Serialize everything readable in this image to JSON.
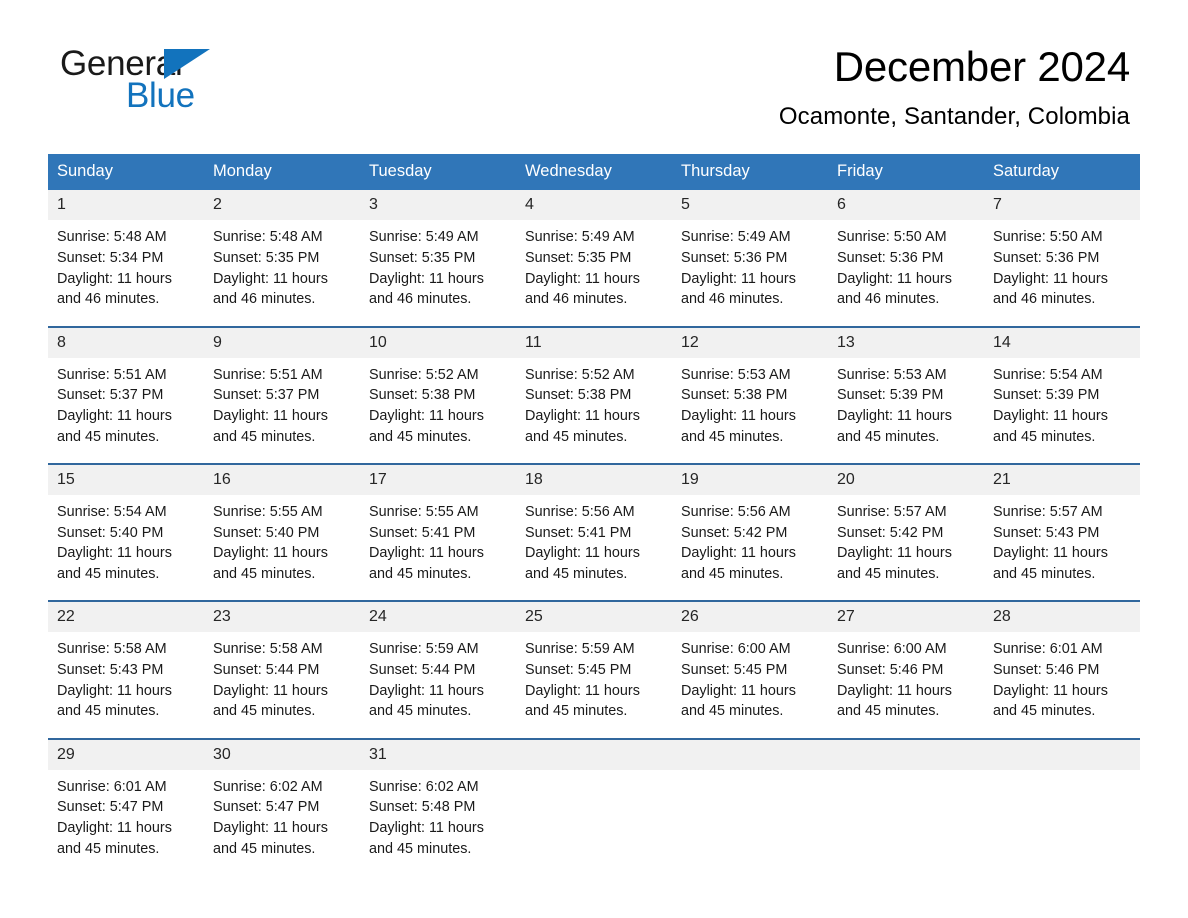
{
  "brand": {
    "name_part1": "General",
    "name_part2": "Blue",
    "accent_color": "#1273bd"
  },
  "header": {
    "title": "December 2024",
    "location": "Ocamonte, Santander, Colombia"
  },
  "theme": {
    "header_blue": "#3076b8",
    "row_divider_blue": "#31679d",
    "daynum_background": "#f1f1f1"
  },
  "calendar": {
    "weekday_headers": [
      "Sunday",
      "Monday",
      "Tuesday",
      "Wednesday",
      "Thursday",
      "Friday",
      "Saturday"
    ],
    "weeks": [
      [
        {
          "day": "1",
          "sunrise": "Sunrise: 5:48 AM",
          "sunset": "Sunset: 5:34 PM",
          "daylight": "Daylight: 11 hours and 46 minutes."
        },
        {
          "day": "2",
          "sunrise": "Sunrise: 5:48 AM",
          "sunset": "Sunset: 5:35 PM",
          "daylight": "Daylight: 11 hours and 46 minutes."
        },
        {
          "day": "3",
          "sunrise": "Sunrise: 5:49 AM",
          "sunset": "Sunset: 5:35 PM",
          "daylight": "Daylight: 11 hours and 46 minutes."
        },
        {
          "day": "4",
          "sunrise": "Sunrise: 5:49 AM",
          "sunset": "Sunset: 5:35 PM",
          "daylight": "Daylight: 11 hours and 46 minutes."
        },
        {
          "day": "5",
          "sunrise": "Sunrise: 5:49 AM",
          "sunset": "Sunset: 5:36 PM",
          "daylight": "Daylight: 11 hours and 46 minutes."
        },
        {
          "day": "6",
          "sunrise": "Sunrise: 5:50 AM",
          "sunset": "Sunset: 5:36 PM",
          "daylight": "Daylight: 11 hours and 46 minutes."
        },
        {
          "day": "7",
          "sunrise": "Sunrise: 5:50 AM",
          "sunset": "Sunset: 5:36 PM",
          "daylight": "Daylight: 11 hours and 46 minutes."
        }
      ],
      [
        {
          "day": "8",
          "sunrise": "Sunrise: 5:51 AM",
          "sunset": "Sunset: 5:37 PM",
          "daylight": "Daylight: 11 hours and 45 minutes."
        },
        {
          "day": "9",
          "sunrise": "Sunrise: 5:51 AM",
          "sunset": "Sunset: 5:37 PM",
          "daylight": "Daylight: 11 hours and 45 minutes."
        },
        {
          "day": "10",
          "sunrise": "Sunrise: 5:52 AM",
          "sunset": "Sunset: 5:38 PM",
          "daylight": "Daylight: 11 hours and 45 minutes."
        },
        {
          "day": "11",
          "sunrise": "Sunrise: 5:52 AM",
          "sunset": "Sunset: 5:38 PM",
          "daylight": "Daylight: 11 hours and 45 minutes."
        },
        {
          "day": "12",
          "sunrise": "Sunrise: 5:53 AM",
          "sunset": "Sunset: 5:38 PM",
          "daylight": "Daylight: 11 hours and 45 minutes."
        },
        {
          "day": "13",
          "sunrise": "Sunrise: 5:53 AM",
          "sunset": "Sunset: 5:39 PM",
          "daylight": "Daylight: 11 hours and 45 minutes."
        },
        {
          "day": "14",
          "sunrise": "Sunrise: 5:54 AM",
          "sunset": "Sunset: 5:39 PM",
          "daylight": "Daylight: 11 hours and 45 minutes."
        }
      ],
      [
        {
          "day": "15",
          "sunrise": "Sunrise: 5:54 AM",
          "sunset": "Sunset: 5:40 PM",
          "daylight": "Daylight: 11 hours and 45 minutes."
        },
        {
          "day": "16",
          "sunrise": "Sunrise: 5:55 AM",
          "sunset": "Sunset: 5:40 PM",
          "daylight": "Daylight: 11 hours and 45 minutes."
        },
        {
          "day": "17",
          "sunrise": "Sunrise: 5:55 AM",
          "sunset": "Sunset: 5:41 PM",
          "daylight": "Daylight: 11 hours and 45 minutes."
        },
        {
          "day": "18",
          "sunrise": "Sunrise: 5:56 AM",
          "sunset": "Sunset: 5:41 PM",
          "daylight": "Daylight: 11 hours and 45 minutes."
        },
        {
          "day": "19",
          "sunrise": "Sunrise: 5:56 AM",
          "sunset": "Sunset: 5:42 PM",
          "daylight": "Daylight: 11 hours and 45 minutes."
        },
        {
          "day": "20",
          "sunrise": "Sunrise: 5:57 AM",
          "sunset": "Sunset: 5:42 PM",
          "daylight": "Daylight: 11 hours and 45 minutes."
        },
        {
          "day": "21",
          "sunrise": "Sunrise: 5:57 AM",
          "sunset": "Sunset: 5:43 PM",
          "daylight": "Daylight: 11 hours and 45 minutes."
        }
      ],
      [
        {
          "day": "22",
          "sunrise": "Sunrise: 5:58 AM",
          "sunset": "Sunset: 5:43 PM",
          "daylight": "Daylight: 11 hours and 45 minutes."
        },
        {
          "day": "23",
          "sunrise": "Sunrise: 5:58 AM",
          "sunset": "Sunset: 5:44 PM",
          "daylight": "Daylight: 11 hours and 45 minutes."
        },
        {
          "day": "24",
          "sunrise": "Sunrise: 5:59 AM",
          "sunset": "Sunset: 5:44 PM",
          "daylight": "Daylight: 11 hours and 45 minutes."
        },
        {
          "day": "25",
          "sunrise": "Sunrise: 5:59 AM",
          "sunset": "Sunset: 5:45 PM",
          "daylight": "Daylight: 11 hours and 45 minutes."
        },
        {
          "day": "26",
          "sunrise": "Sunrise: 6:00 AM",
          "sunset": "Sunset: 5:45 PM",
          "daylight": "Daylight: 11 hours and 45 minutes."
        },
        {
          "day": "27",
          "sunrise": "Sunrise: 6:00 AM",
          "sunset": "Sunset: 5:46 PM",
          "daylight": "Daylight: 11 hours and 45 minutes."
        },
        {
          "day": "28",
          "sunrise": "Sunrise: 6:01 AM",
          "sunset": "Sunset: 5:46 PM",
          "daylight": "Daylight: 11 hours and 45 minutes."
        }
      ],
      [
        {
          "day": "29",
          "sunrise": "Sunrise: 6:01 AM",
          "sunset": "Sunset: 5:47 PM",
          "daylight": "Daylight: 11 hours and 45 minutes."
        },
        {
          "day": "30",
          "sunrise": "Sunrise: 6:02 AM",
          "sunset": "Sunset: 5:47 PM",
          "daylight": "Daylight: 11 hours and 45 minutes."
        },
        {
          "day": "31",
          "sunrise": "Sunrise: 6:02 AM",
          "sunset": "Sunset: 5:48 PM",
          "daylight": "Daylight: 11 hours and 45 minutes."
        },
        {
          "day": "",
          "sunrise": "",
          "sunset": "",
          "daylight": ""
        },
        {
          "day": "",
          "sunrise": "",
          "sunset": "",
          "daylight": ""
        },
        {
          "day": "",
          "sunrise": "",
          "sunset": "",
          "daylight": ""
        },
        {
          "day": "",
          "sunrise": "",
          "sunset": "",
          "daylight": ""
        }
      ]
    ]
  }
}
